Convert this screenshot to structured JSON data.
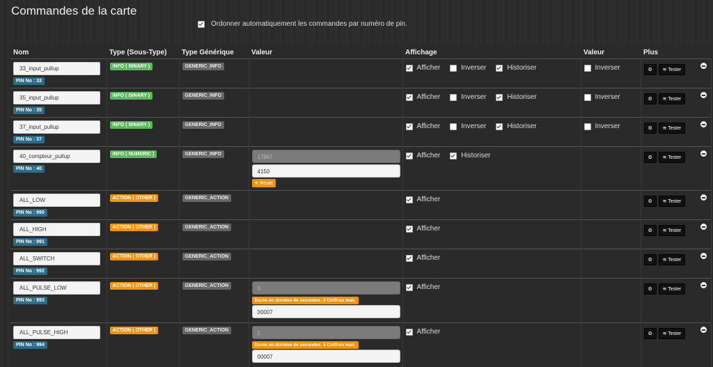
{
  "page": {
    "title": "Commandes de la carte",
    "autosort_label": "Ordonner automatiquement les commandes par numéro de pin."
  },
  "headers": {
    "nom": "Nom",
    "type": "Type (Sous-Type)",
    "generic": "Type Générique",
    "valeur": "Valeur",
    "affichage": "Affichage",
    "valeur2": "Valeur",
    "plus": "Plus"
  },
  "labels": {
    "afficher": "Afficher",
    "inverser": "Inverser",
    "historiser": "Historiser",
    "tester": "Tester",
    "reset": "Reset",
    "hint": "Durée en dixième de secondes. 5 Chiffres max."
  },
  "rows": [
    {
      "name": "33_input_pullup",
      "pin": "PIN No : 33",
      "type": "INFO ( BINARY )",
      "generic": "GENERIC_INFO"
    },
    {
      "name": "35_input_pullup",
      "pin": "PIN No : 35",
      "type": "INFO ( BINARY )",
      "generic": "GENERIC_INFO"
    },
    {
      "name": "37_input_pullup",
      "pin": "PIN No : 37",
      "type": "INFO ( BINARY )",
      "generic": "GENERIC_INFO"
    },
    {
      "name": "40_compteur_pullup",
      "pin": "PIN No : 40",
      "type": "INFO ( NUMERIC )",
      "generic": "GENERIC_INFO",
      "val1": "17967",
      "val2": "4150"
    },
    {
      "name": "ALL_LOW",
      "pin": "PIN No : 990",
      "type": "ACTION ( OTHER )",
      "generic": "GENERIC_ACTION"
    },
    {
      "name": "ALL_HIGH",
      "pin": "PIN No : 991",
      "type": "ACTION ( OTHER )",
      "generic": "GENERIC_ACTION"
    },
    {
      "name": "ALL_SWITCH",
      "pin": "PIN No : 992",
      "type": "ACTION ( OTHER )",
      "generic": "GENERIC_ACTION"
    },
    {
      "name": "ALL_PULSE_LOW",
      "pin": "PIN No : 993",
      "type": "ACTION ( OTHER )",
      "generic": "GENERIC_ACTION",
      "val1": "0",
      "val2": "00007"
    },
    {
      "name": "ALL_PULSE_HIGH",
      "pin": "PIN No : 994",
      "type": "ACTION ( OTHER )",
      "generic": "GENERIC_ACTION",
      "val1": "1",
      "val2": "00007"
    }
  ]
}
